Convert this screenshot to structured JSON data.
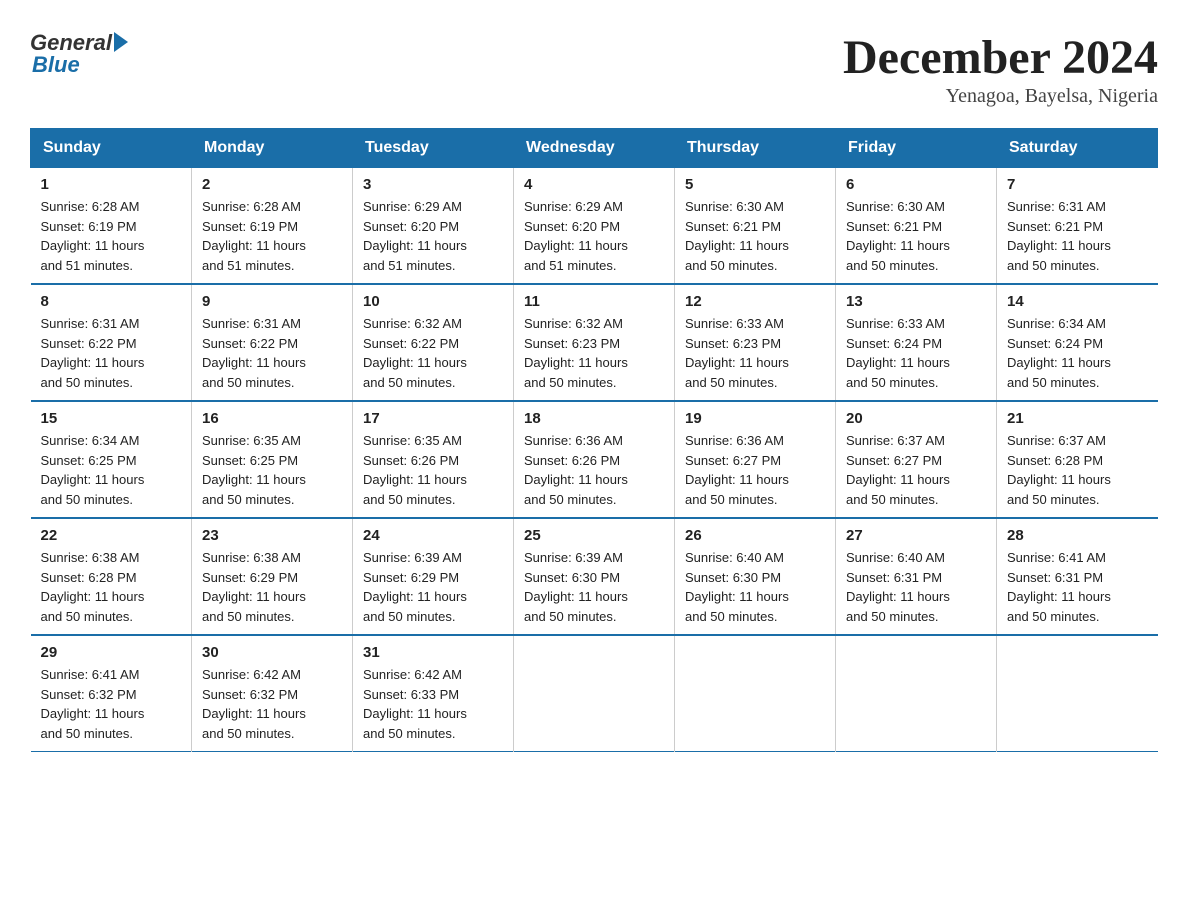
{
  "logo": {
    "general": "General",
    "blue": "Blue"
  },
  "title": "December 2024",
  "location": "Yenagoa, Bayelsa, Nigeria",
  "days_of_week": [
    "Sunday",
    "Monday",
    "Tuesday",
    "Wednesday",
    "Thursday",
    "Friday",
    "Saturday"
  ],
  "weeks": [
    [
      {
        "day": "1",
        "sunrise": "6:28 AM",
        "sunset": "6:19 PM",
        "daylight": "11 hours and 51 minutes."
      },
      {
        "day": "2",
        "sunrise": "6:28 AM",
        "sunset": "6:19 PM",
        "daylight": "11 hours and 51 minutes."
      },
      {
        "day": "3",
        "sunrise": "6:29 AM",
        "sunset": "6:20 PM",
        "daylight": "11 hours and 51 minutes."
      },
      {
        "day": "4",
        "sunrise": "6:29 AM",
        "sunset": "6:20 PM",
        "daylight": "11 hours and 51 minutes."
      },
      {
        "day": "5",
        "sunrise": "6:30 AM",
        "sunset": "6:21 PM",
        "daylight": "11 hours and 50 minutes."
      },
      {
        "day": "6",
        "sunrise": "6:30 AM",
        "sunset": "6:21 PM",
        "daylight": "11 hours and 50 minutes."
      },
      {
        "day": "7",
        "sunrise": "6:31 AM",
        "sunset": "6:21 PM",
        "daylight": "11 hours and 50 minutes."
      }
    ],
    [
      {
        "day": "8",
        "sunrise": "6:31 AM",
        "sunset": "6:22 PM",
        "daylight": "11 hours and 50 minutes."
      },
      {
        "day": "9",
        "sunrise": "6:31 AM",
        "sunset": "6:22 PM",
        "daylight": "11 hours and 50 minutes."
      },
      {
        "day": "10",
        "sunrise": "6:32 AM",
        "sunset": "6:22 PM",
        "daylight": "11 hours and 50 minutes."
      },
      {
        "day": "11",
        "sunrise": "6:32 AM",
        "sunset": "6:23 PM",
        "daylight": "11 hours and 50 minutes."
      },
      {
        "day": "12",
        "sunrise": "6:33 AM",
        "sunset": "6:23 PM",
        "daylight": "11 hours and 50 minutes."
      },
      {
        "day": "13",
        "sunrise": "6:33 AM",
        "sunset": "6:24 PM",
        "daylight": "11 hours and 50 minutes."
      },
      {
        "day": "14",
        "sunrise": "6:34 AM",
        "sunset": "6:24 PM",
        "daylight": "11 hours and 50 minutes."
      }
    ],
    [
      {
        "day": "15",
        "sunrise": "6:34 AM",
        "sunset": "6:25 PM",
        "daylight": "11 hours and 50 minutes."
      },
      {
        "day": "16",
        "sunrise": "6:35 AM",
        "sunset": "6:25 PM",
        "daylight": "11 hours and 50 minutes."
      },
      {
        "day": "17",
        "sunrise": "6:35 AM",
        "sunset": "6:26 PM",
        "daylight": "11 hours and 50 minutes."
      },
      {
        "day": "18",
        "sunrise": "6:36 AM",
        "sunset": "6:26 PM",
        "daylight": "11 hours and 50 minutes."
      },
      {
        "day": "19",
        "sunrise": "6:36 AM",
        "sunset": "6:27 PM",
        "daylight": "11 hours and 50 minutes."
      },
      {
        "day": "20",
        "sunrise": "6:37 AM",
        "sunset": "6:27 PM",
        "daylight": "11 hours and 50 minutes."
      },
      {
        "day": "21",
        "sunrise": "6:37 AM",
        "sunset": "6:28 PM",
        "daylight": "11 hours and 50 minutes."
      }
    ],
    [
      {
        "day": "22",
        "sunrise": "6:38 AM",
        "sunset": "6:28 PM",
        "daylight": "11 hours and 50 minutes."
      },
      {
        "day": "23",
        "sunrise": "6:38 AM",
        "sunset": "6:29 PM",
        "daylight": "11 hours and 50 minutes."
      },
      {
        "day": "24",
        "sunrise": "6:39 AM",
        "sunset": "6:29 PM",
        "daylight": "11 hours and 50 minutes."
      },
      {
        "day": "25",
        "sunrise": "6:39 AM",
        "sunset": "6:30 PM",
        "daylight": "11 hours and 50 minutes."
      },
      {
        "day": "26",
        "sunrise": "6:40 AM",
        "sunset": "6:30 PM",
        "daylight": "11 hours and 50 minutes."
      },
      {
        "day": "27",
        "sunrise": "6:40 AM",
        "sunset": "6:31 PM",
        "daylight": "11 hours and 50 minutes."
      },
      {
        "day": "28",
        "sunrise": "6:41 AM",
        "sunset": "6:31 PM",
        "daylight": "11 hours and 50 minutes."
      }
    ],
    [
      {
        "day": "29",
        "sunrise": "6:41 AM",
        "sunset": "6:32 PM",
        "daylight": "11 hours and 50 minutes."
      },
      {
        "day": "30",
        "sunrise": "6:42 AM",
        "sunset": "6:32 PM",
        "daylight": "11 hours and 50 minutes."
      },
      {
        "day": "31",
        "sunrise": "6:42 AM",
        "sunset": "6:33 PM",
        "daylight": "11 hours and 50 minutes."
      },
      null,
      null,
      null,
      null
    ]
  ],
  "labels": {
    "sunrise": "Sunrise:",
    "sunset": "Sunset:",
    "daylight": "Daylight: 11 hours"
  }
}
